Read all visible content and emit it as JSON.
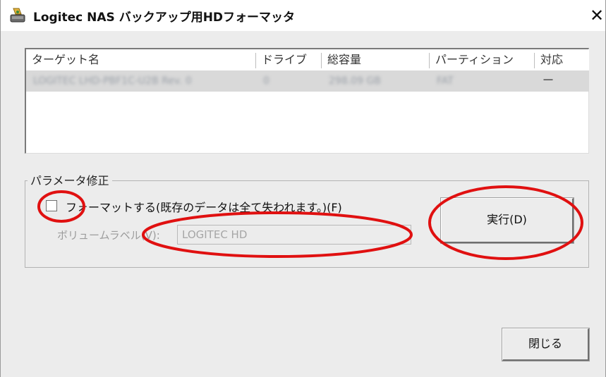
{
  "window": {
    "title": "Logitec NAS バックアップ用HDフォーマッタ",
    "close_label": "✕"
  },
  "list": {
    "columns": [
      "ターゲット名",
      "ドライブ",
      "総容量",
      "パーティション",
      "対応"
    ],
    "rows": [
      {
        "target": "LOGITEC LHD-PBF1C-U2B Rev. 0",
        "drive": "0",
        "capacity": "298.09 GB",
        "partition": "FAT",
        "support": "－"
      }
    ]
  },
  "params": {
    "group_label": "パラメータ修正",
    "format_checkbox_label": "フォーマットする(既存のデータは全て失われます。)(F)",
    "format_checked": false,
    "volume_label_caption": "ボリュームラベル(V):",
    "volume_label_value": "LOGITEC HD",
    "execute_label": "実行(D)"
  },
  "footer": {
    "close_button_label": "閉じる"
  },
  "annotations": {
    "circle_color": "#e01010"
  },
  "colors": {
    "window_bg": "#ececec",
    "selected_row_bg": "#d9d9d9"
  }
}
